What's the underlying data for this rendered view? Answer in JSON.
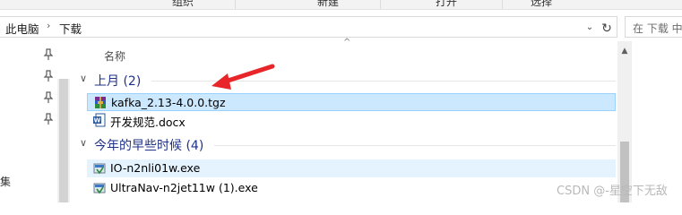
{
  "ribbon": {
    "labels": [
      "组织",
      "新建",
      "打开",
      "选择"
    ]
  },
  "address": {
    "crumbs": [
      "此电脑",
      "下载"
    ],
    "search_placeholder": "在 下载 中"
  },
  "nav": {
    "truncated_item": "集"
  },
  "columns": {
    "name": "名称"
  },
  "groups": [
    {
      "title": "上月 (2)",
      "files": [
        {
          "name": "kafka_2.13-4.0.0.tgz",
          "icon": "winrar-archive-icon",
          "selected": true
        },
        {
          "name": "开发规范.docx",
          "icon": "word-document-icon",
          "selected": false
        }
      ]
    },
    {
      "title": "今年的早些时候 (4)",
      "files": [
        {
          "name": "IO-n2nli01w.exe",
          "icon": "installer-exe-icon",
          "selected": false
        },
        {
          "name": "UltraNav-n2jet11w (1).exe",
          "icon": "installer-exe-icon",
          "selected": false
        }
      ]
    }
  ],
  "watermark": "CSDN @-星空下无敌",
  "colors": {
    "annotation_arrow": "#e8262a",
    "selection": "#cce8ff",
    "group_title": "#1e3287"
  }
}
